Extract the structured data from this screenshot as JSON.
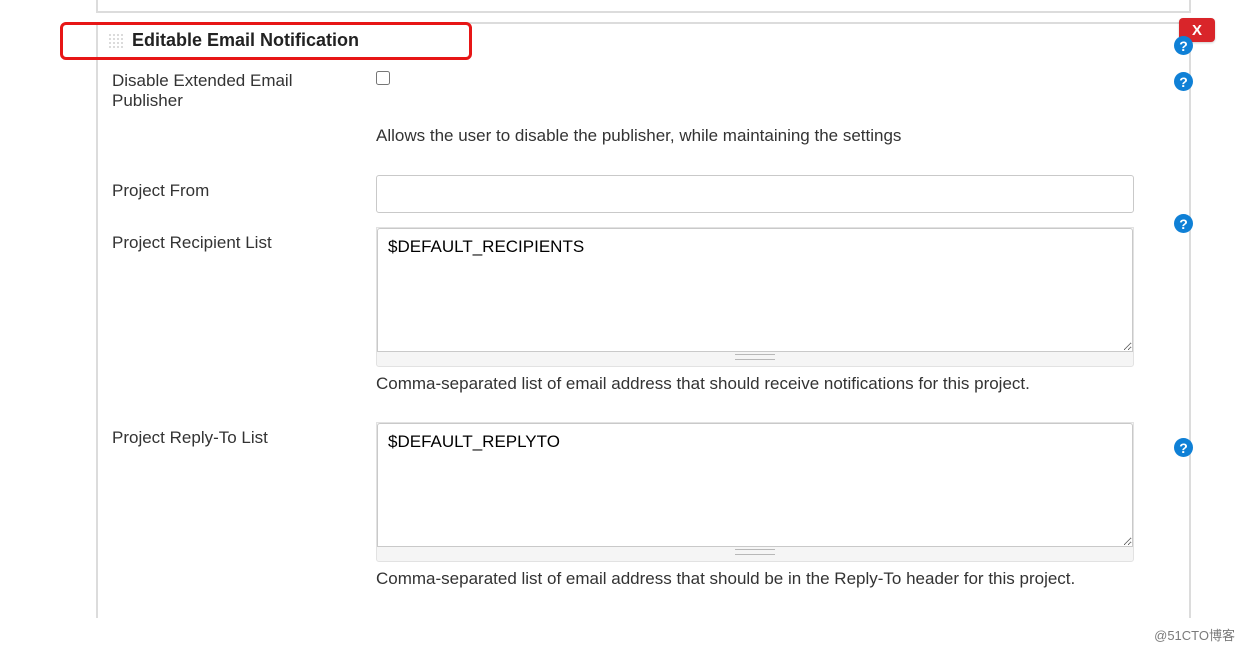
{
  "section": {
    "title": "Editable Email Notification",
    "close_label": "X"
  },
  "fields": {
    "disable_publisher": {
      "label": "Disable Extended Email Publisher",
      "checked": false,
      "hint": "Allows the user to disable the publisher, while maintaining the settings"
    },
    "project_from": {
      "label": "Project From",
      "value": ""
    },
    "recipient_list": {
      "label": "Project Recipient List",
      "value": "$DEFAULT_RECIPIENTS",
      "hint": "Comma-separated list of email address that should receive notifications for this project."
    },
    "reply_to_list": {
      "label": "Project Reply-To List",
      "value": "$DEFAULT_REPLYTO",
      "hint": "Comma-separated list of email address that should be in the Reply-To header for this project."
    }
  },
  "help_glyph": "?",
  "watermark": "@51CTO博客"
}
